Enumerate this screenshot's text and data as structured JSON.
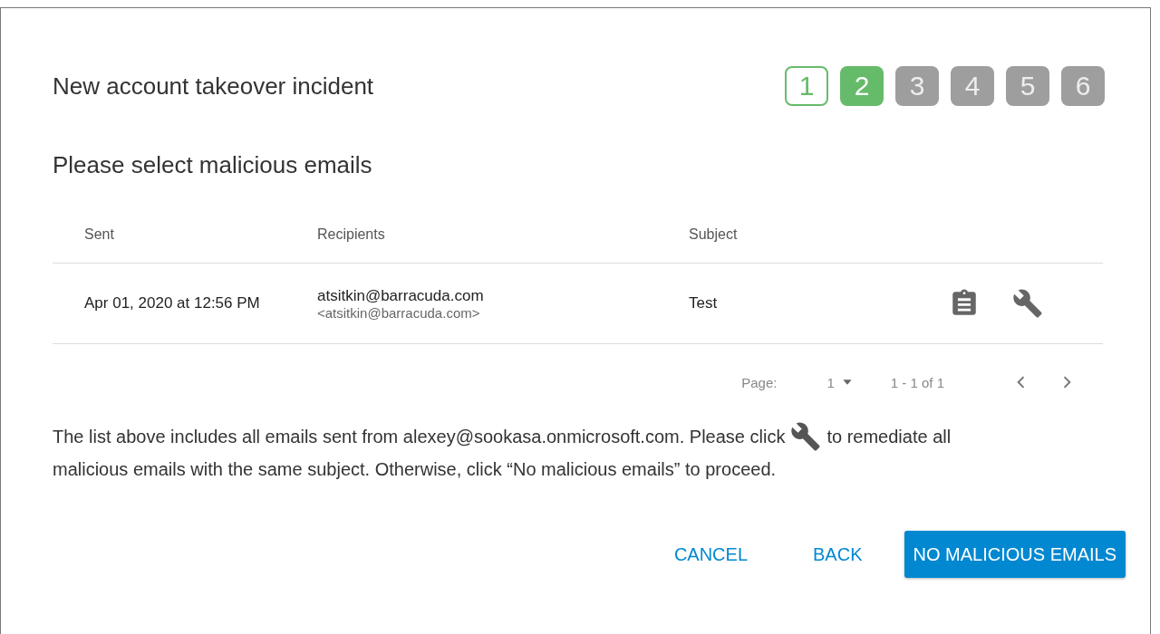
{
  "dialog": {
    "title": "New account takeover incident",
    "steps": [
      {
        "label": "1",
        "completed": true,
        "selected": false
      },
      {
        "label": "2",
        "completed": false,
        "selected": true
      },
      {
        "label": "3",
        "completed": false,
        "selected": false
      },
      {
        "label": "4",
        "completed": false,
        "selected": false
      },
      {
        "label": "5",
        "completed": false,
        "selected": false
      },
      {
        "label": "6",
        "completed": false,
        "selected": false
      }
    ],
    "subtitle": "Please select malicious emails",
    "table": {
      "columns": [
        "Sent",
        "Recipients",
        "Subject"
      ],
      "rows": [
        {
          "sent": "Apr 01, 2020 at 12:56 PM",
          "recipient_name": "atsitkin@barracuda.com",
          "recipient_address": "<atsitkin@barracuda.com>",
          "subject": "Test"
        }
      ]
    },
    "pager": {
      "label": "Page:",
      "page": "1",
      "range": "1 - 1 of 1"
    },
    "note_before": "The list above includes all emails sent from alexey@sookasa.onmicrosoft.com. Please click",
    "note_after": "to remediate all",
    "note_line_2": "malicious emails with the same subject. Otherwise, click “No malicious emails” to proceed.",
    "buttons": [
      {
        "label": "CANCEL",
        "kind": "text"
      },
      {
        "label": "BACK",
        "kind": "text"
      },
      {
        "label": "NO MALICIOUS EMAILS",
        "kind": "primary"
      }
    ]
  }
}
